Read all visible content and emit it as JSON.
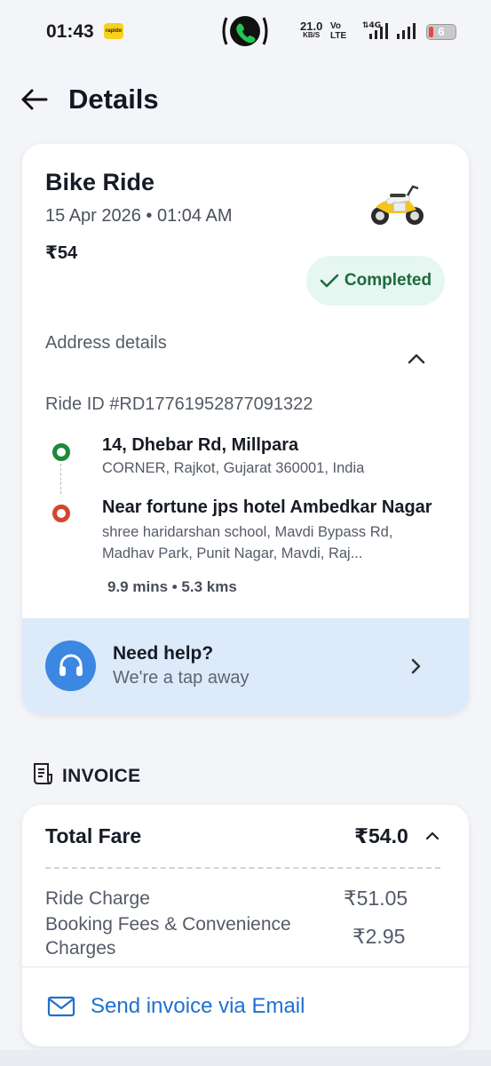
{
  "status_bar": {
    "time": "01:43",
    "app_icon_label": "rapido",
    "net_speed": "21.0",
    "net_speed_unit": "KB/S",
    "volte_top": "Vo",
    "volte_bottom": "LTE",
    "battery": "6",
    "icons": [
      "call-icon",
      "4g-signal-icon",
      "signal-icon",
      "battery-icon"
    ]
  },
  "header": {
    "title": "Details",
    "back_icon": "arrow-left-icon"
  },
  "ride": {
    "type": "Bike Ride",
    "date": "15 Apr 2026 • 01:04 AM",
    "price": "₹54",
    "status": "Completed",
    "address_section_title": "Address details",
    "ride_id": "Ride ID #RD17761952877091322",
    "pickup": {
      "title": "14, Dhebar Rd, Millpara",
      "subtitle": "CORNER, Rajkot, Gujarat 360001, India"
    },
    "drop": {
      "title": "Near fortune jps hotel Ambedkar Nagar",
      "subtitle": "shree haridarshan school, Mavdi Bypass Rd, Madhav Park, Punit Nagar, Mavdi, Raj..."
    },
    "trip_stats": "9.9 mins • 5.3 kms"
  },
  "help": {
    "title": "Need help?",
    "subtitle": "We're a tap away"
  },
  "invoice": {
    "section_title": "INVOICE",
    "total_label": "Total Fare",
    "total_value": "₹54.0",
    "lines": [
      {
        "label": "Ride Charge",
        "value": "₹51.05"
      },
      {
        "label": "Booking Fees & Convenience Charges",
        "value": "₹2.95"
      }
    ],
    "email_label": "Send invoice via Email"
  },
  "colors": {
    "accent_blue": "#1f70cf",
    "help_bg": "#dceaf9",
    "status_green": "#1b6b3c",
    "pickup_green": "#1c8a3a",
    "drop_red": "#d3472f"
  }
}
